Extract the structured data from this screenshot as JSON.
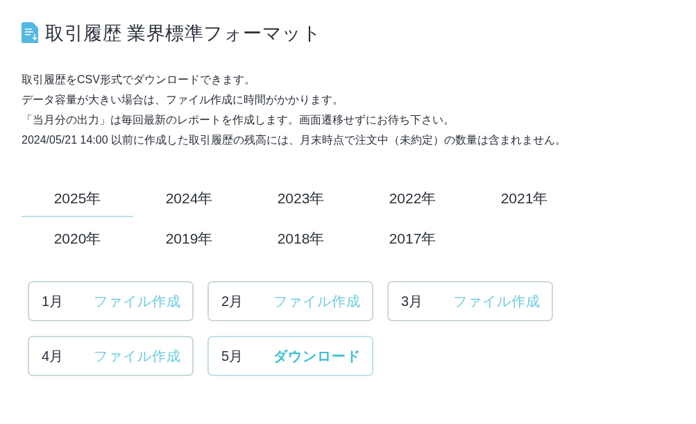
{
  "title": "取引履歴 業界標準フォーマット",
  "description": [
    "取引履歴をCSV形式でダウンロードできます。",
    "データ容量が大きい場合は、ファイル作成に時間がかかります。",
    "「当月分の出力」は毎回最新のレポートを作成します。画面遷移せずにお待ち下さい。",
    "2024/05/21 14:00 以前に作成した取引履歴の残高には、月末時点で注文中（未約定）の数量は含まれません。"
  ],
  "year_tabs": [
    {
      "label": "2025年",
      "selected": true
    },
    {
      "label": "2024年",
      "selected": false
    },
    {
      "label": "2023年",
      "selected": false
    },
    {
      "label": "2022年",
      "selected": false
    },
    {
      "label": "2021年",
      "selected": false
    },
    {
      "label": "2020年",
      "selected": false
    },
    {
      "label": "2019年",
      "selected": false
    },
    {
      "label": "2018年",
      "selected": false
    },
    {
      "label": "2017年",
      "selected": false
    }
  ],
  "months": [
    {
      "month": "1月",
      "kind": "create",
      "action": "ファイル作成"
    },
    {
      "month": "2月",
      "kind": "create",
      "action": "ファイル作成"
    },
    {
      "month": "3月",
      "kind": "create",
      "action": "ファイル作成"
    },
    {
      "month": "4月",
      "kind": "create",
      "action": "ファイル作成"
    },
    {
      "month": "5月",
      "kind": "download",
      "action": "ダウンロード"
    }
  ]
}
